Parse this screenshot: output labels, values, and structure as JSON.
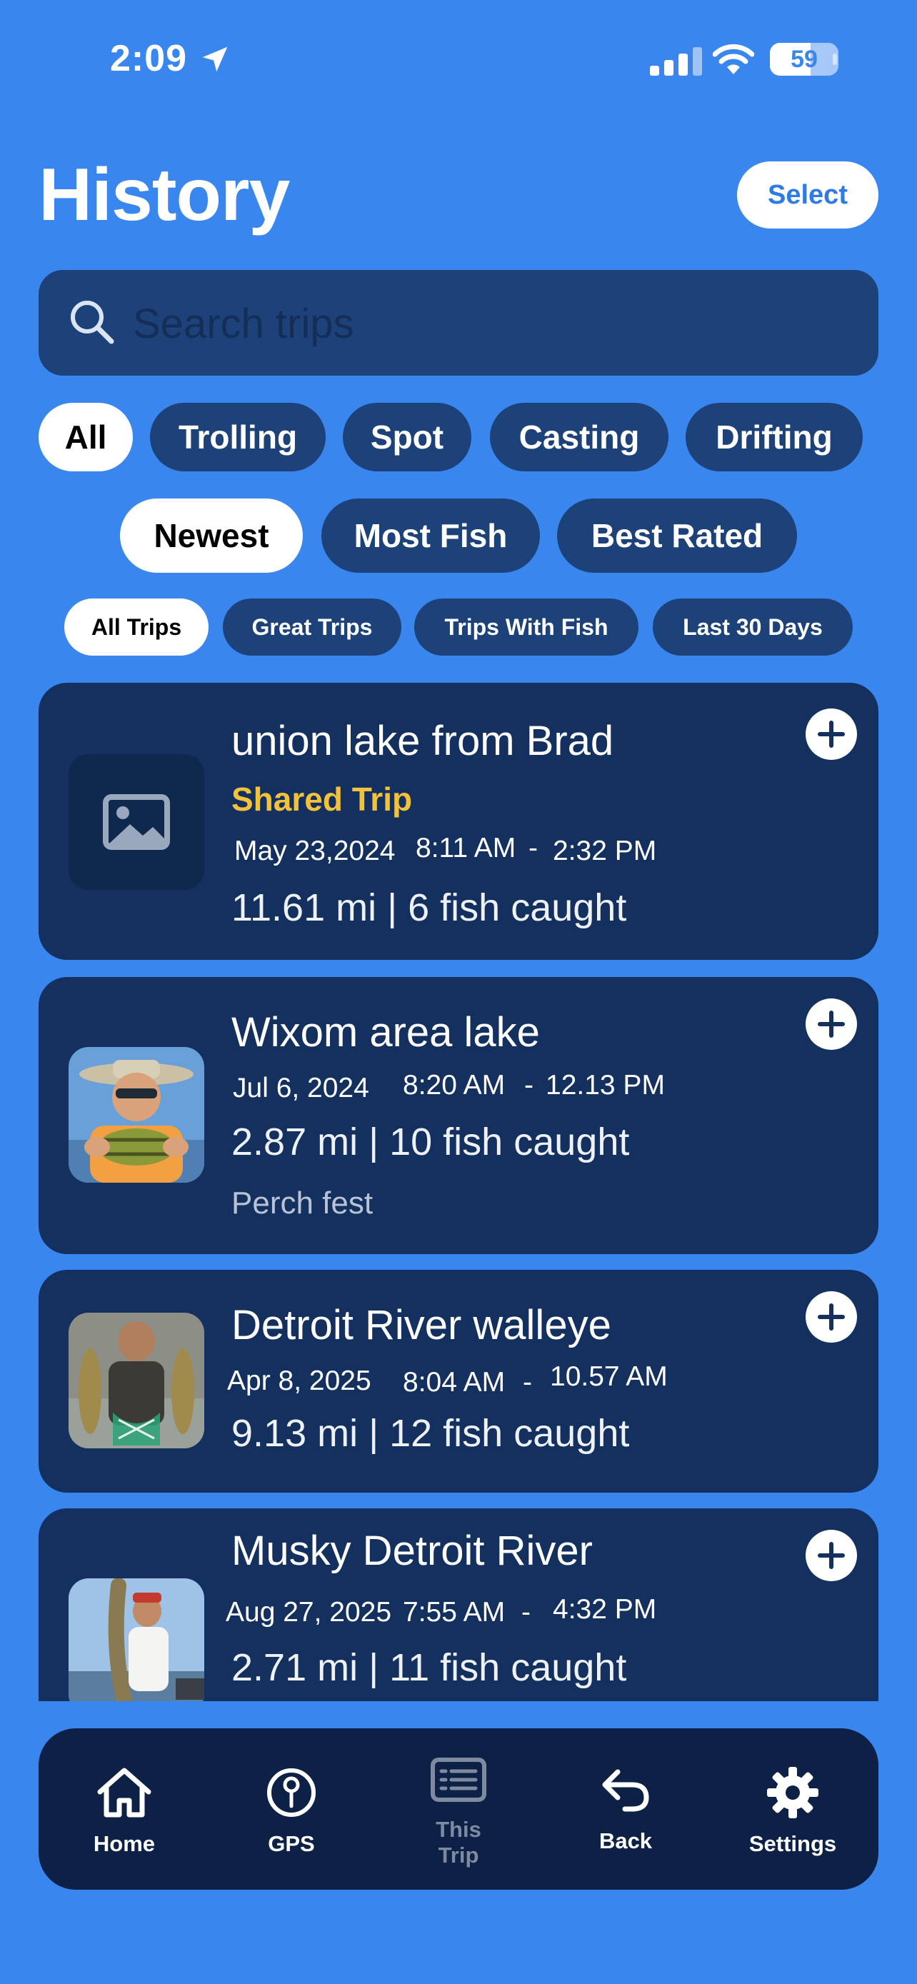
{
  "status_bar": {
    "time": "2:09",
    "battery": "59",
    "battery_fraction": 0.59,
    "icons": [
      "location-arrow-icon",
      "cellular-signal-icon",
      "wifi-icon",
      "battery-icon"
    ]
  },
  "header": {
    "title": "History",
    "select_label": "Select"
  },
  "search": {
    "placeholder": "Search trips",
    "value": ""
  },
  "filters": {
    "method": [
      "All",
      "Trolling",
      "Spot",
      "Casting",
      "Drifting"
    ],
    "method_selected": "All",
    "sort": [
      "Newest",
      "Most Fish",
      "Best Rated"
    ],
    "sort_selected": "Newest",
    "range": [
      "All Trips",
      "Great Trips",
      "Trips With Fish",
      "Last 30 Days"
    ],
    "range_selected": "All Trips"
  },
  "trips": [
    {
      "title": "union lake from Brad",
      "shared_label": "Shared Trip",
      "date": "May 23,2024",
      "start_time": "8:11 AM",
      "end_time": "2:32 PM",
      "stats": "11.61 mi | 6 fish caught",
      "note": "",
      "thumbnail": "image-placeholder-icon"
    },
    {
      "title": "Wixom area lake",
      "date": "Jul 6, 2024",
      "start_time": "8:20 AM",
      "end_time": "12.13 PM",
      "stats": "2.87 mi | 10 fish caught",
      "note": "Perch fest",
      "thumbnail": "photo-man-holding-perch"
    },
    {
      "title": "Detroit River walleye",
      "date": "Apr 8, 2025",
      "start_time": "8:04 AM",
      "end_time": "10.57 AM",
      "stats": "9.13 mi | 12 fish caught",
      "note": "",
      "thumbnail": "photo-man-holding-walleye"
    },
    {
      "title": "Musky Detroit River",
      "date": "Aug 27, 2025",
      "start_time": "7:55 AM",
      "end_time": "4:32 PM",
      "stats": "2.71 mi | 11 fish caught",
      "note": "",
      "thumbnail": "photo-man-holding-musky"
    }
  ],
  "time_separator": "-",
  "tab_bar": {
    "home": "Home",
    "gps": "GPS",
    "this_trip_line1": "This",
    "this_trip_line2": "Trip",
    "back": "Back",
    "settings": "Settings"
  },
  "colors": {
    "background": "#3a86ef",
    "card": "#13305f",
    "pill": "#1d4279",
    "tab_bar": "#0d2146",
    "shared_accent": "#f3c23b",
    "select_text": "#2f7be6"
  }
}
